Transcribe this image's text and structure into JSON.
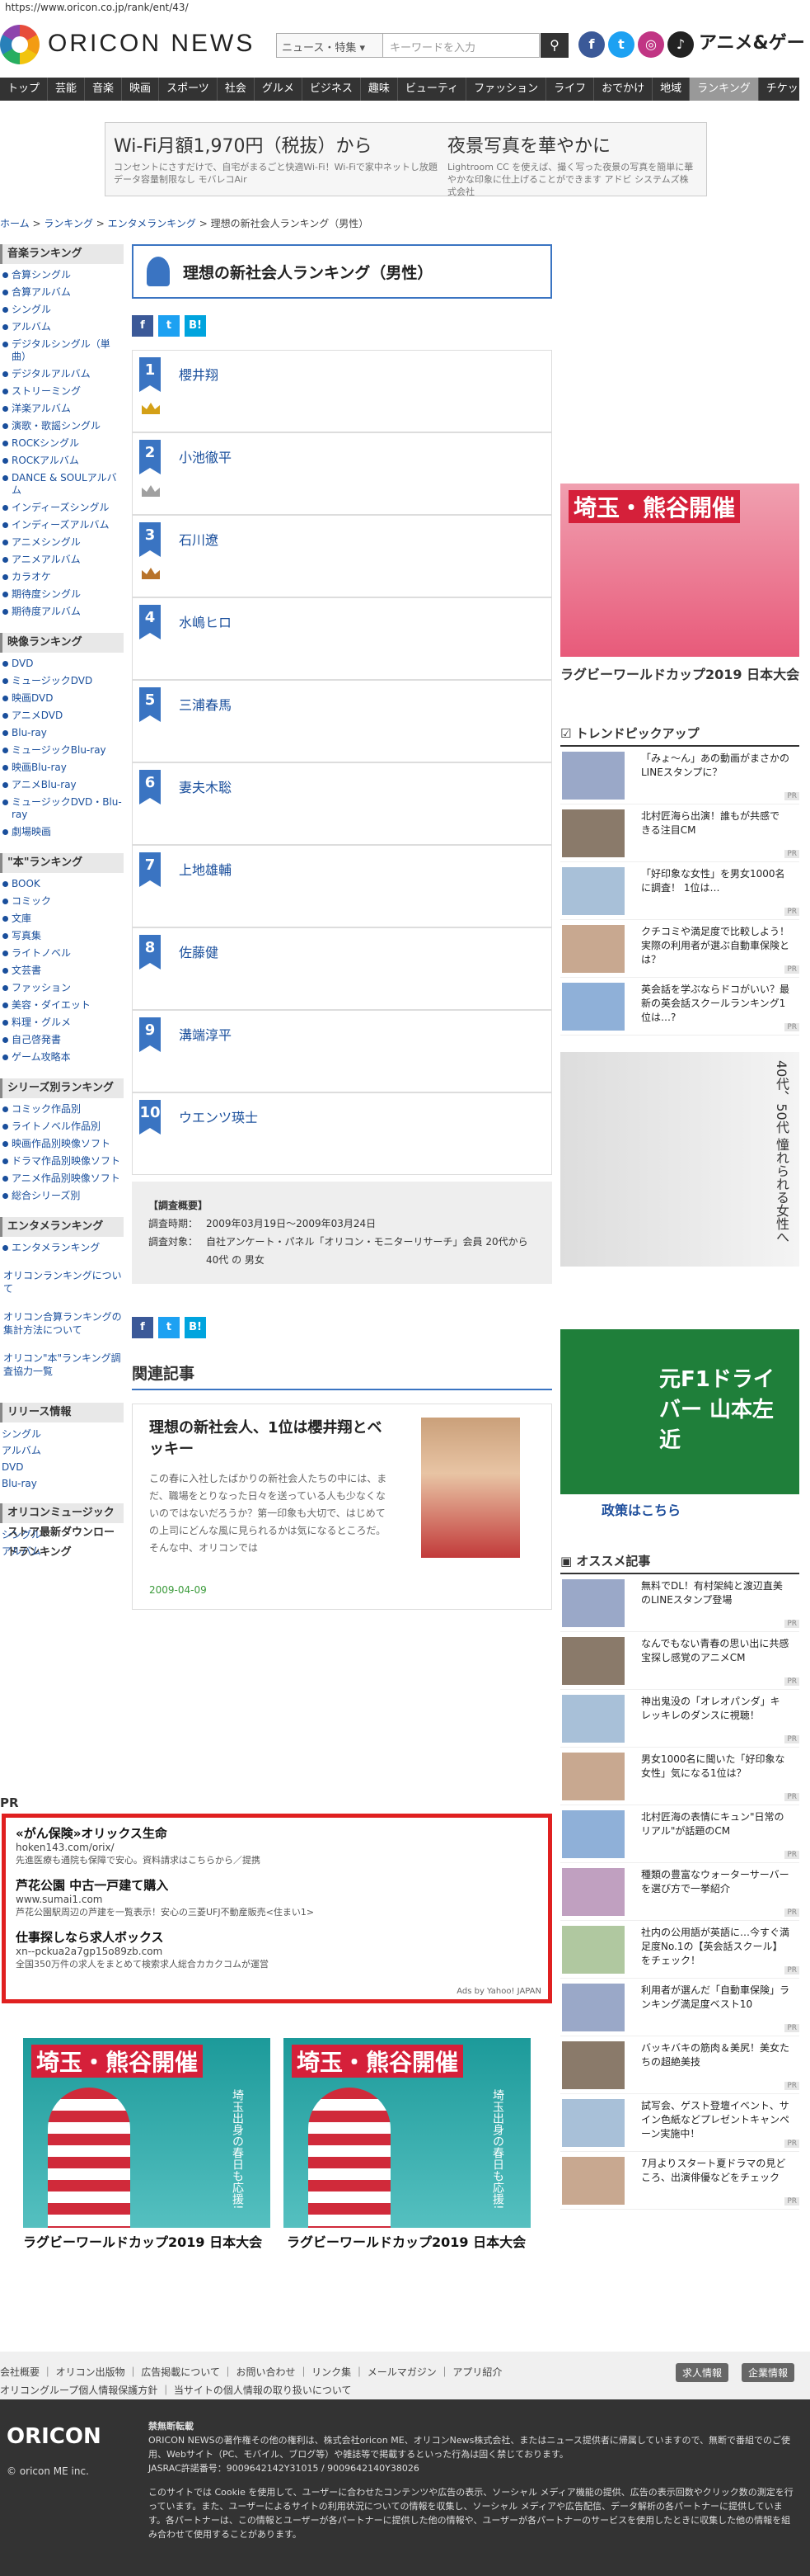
{
  "url": "https://www.oricon.co.jp/rank/ent/43/",
  "header": {
    "logo": "ORICON NEWS",
    "search_select": "ニュース・特集",
    "search_placeholder": "キーワードを入力",
    "anime": "アニメ&ゲー"
  },
  "nav": [
    "トップ",
    "芸能",
    "音楽",
    "映画",
    "スポーツ",
    "社会",
    "グルメ",
    "ビジネス",
    "趣味",
    "ビューティ",
    "ファッション",
    "ライフ",
    "おでかけ",
    "地域",
    "ランキング",
    "チケット"
  ],
  "ad_top": {
    "left_title": "Wi-Fi月額1,970円（税抜）から",
    "left_sub": "コンセントにさすだけで、自宅がまるごと快適Wi-Fi！Wi-Fiで家中ネットし放題データ容量制限なし モバレコAir",
    "right_title": "夜景写真を華やかに",
    "right_sub": "Lightroom CC を使えば、撮く写った夜景の写真を簡単に華やかな印象に仕上げることができます アドビ システムズ株式会社"
  },
  "breadcrumb": [
    "ホーム",
    "ランキング",
    "エンタメランキング",
    "理想の新社会人ランキング（男性）"
  ],
  "sidebar": {
    "music_head": "音楽ランキング",
    "music": [
      "合算シングル",
      "合算アルバム",
      "シングル",
      "アルバム",
      "デジタルシングル（単曲）",
      "デジタルアルバム",
      "ストリーミング",
      "洋楽アルバム",
      "演歌・歌謡シングル",
      "ROCKシングル",
      "ROCKアルバム",
      "DANCE & SOULアルバム",
      "インディーズシングル",
      "インディーズアルバム",
      "アニメシングル",
      "アニメアルバム",
      "カラオケ",
      "期待度シングル",
      "期待度アルバム"
    ],
    "video_head": "映像ランキング",
    "video": [
      "DVD",
      "ミュージックDVD",
      "映画DVD",
      "アニメDVD",
      "Blu-ray",
      "ミュージックBlu-ray",
      "映画Blu-ray",
      "アニメBlu-ray",
      "ミュージックDVD・Blu-ray",
      "劇場映画"
    ],
    "book_head": "\"本\"ランキング",
    "book": [
      "BOOK",
      "コミック",
      "文庫",
      "写真集",
      "ライトノベル",
      "文芸書",
      "ファッション",
      "美容・ダイエット",
      "料理・グルメ",
      "自己啓発書",
      "ゲーム攻略本"
    ],
    "series_head": "シリーズ別ランキング",
    "series": [
      "コミック作品別",
      "ライトノベル作品別",
      "映画作品別映像ソフト",
      "ドラマ作品別映像ソフト",
      "アニメ作品別映像ソフト",
      "総合シリーズ別"
    ],
    "ent_head": "エンタメランキング",
    "ent": [
      "エンタメランキング"
    ],
    "links": [
      "オリコンランキングについて",
      "オリコン合算ランキングの集計方法について",
      "オリコン\"本\"ランキング調査協力一覧"
    ],
    "release_head": "リリース情報",
    "release": [
      "シングル",
      "アルバム",
      "DVD",
      "Blu-ray"
    ],
    "dl_head": "オリコンミュージックストア最新ダウンロードランキング",
    "dl": [
      "シングル",
      "アルバム"
    ]
  },
  "main": {
    "title": "理想の新社会人ランキング（男性）",
    "share": [
      "f",
      "t",
      "B!"
    ],
    "ranks": [
      {
        "num": "1",
        "name": "櫻井翔"
      },
      {
        "num": "2",
        "name": "小池徹平"
      },
      {
        "num": "3",
        "name": "石川遼"
      },
      {
        "num": "4",
        "name": "水嶋ヒロ"
      },
      {
        "num": "5",
        "name": "三浦春馬"
      },
      {
        "num": "6",
        "name": "妻夫木聡"
      },
      {
        "num": "7",
        "name": "上地雄輔"
      },
      {
        "num": "8",
        "name": "佐藤健"
      },
      {
        "num": "9",
        "name": "溝端淳平"
      },
      {
        "num": "10",
        "name": "ウエンツ瑛士"
      }
    ],
    "survey": {
      "title": "【調査概要】",
      "period_k": "調査時期：",
      "period_v": "2009年03月19日〜2009年03月24日",
      "target_k": "調査対象：",
      "target_v": "自社アンケート・パネル「オリコン・モニターリサーチ」会員 20代から40代 の 男女"
    },
    "related_head": "関連記事",
    "related": {
      "title": "理想の新社会人、1位は櫻井翔とベッキー",
      "excerpt": "この春に入社したばかりの新社会人たちの中には、まだ、職場をとりなった日々を送っている人も少なくないのではないだろうか？第一印象も大切で、はじめての上司にどんな風に見られるかは気になるところだ。そんな中、オリコンでは",
      "date": "2009-04-09"
    }
  },
  "pr": {
    "label": "PR",
    "items": [
      {
        "title": "«がん保険»オリックス生命",
        "url": "hoken143.com/orix/",
        "desc": "先進医療も通院も保障で安心。資料請求はこちらから／提携"
      },
      {
        "title": "芦花公園 中古一戸建て購入",
        "url": "www.sumai1.com",
        "desc": "芦花公園駅周辺の芦建を一覧表示！安心の三菱UFJ不動産販売<住まい1>"
      },
      {
        "title": "仕事探しなら求人ボックス",
        "url": "xn--pckua2a7gp15o89zb.com",
        "desc": "全国350万件の求人をまとめて検索求人総合カカクコムが運営"
      }
    ],
    "foot": "Ads by Yahoo! JAPAN"
  },
  "banners": {
    "title": "埼玉・熊谷開催",
    "sub": "埼玉出身の春日も応援!",
    "caption": "ラグビーワールドカップ2019 日本大会"
  },
  "right": {
    "banner_title": "埼玉・熊谷開催",
    "banner_caption": "ラグビーワールドカップ2019 日本大会",
    "trend_head": "トレンドピックアップ",
    "trend": [
      "「みょ〜ん」あの動画がまさかのLINEスタンプに？",
      "北村匠海ら出演！誰もが共感できる注目CM",
      "「好印象な女性」を男女1000名に調査！ 1位は…",
      "クチコミや満足度で比較しよう！実際の利用者が選ぶ自動車保険とは？",
      "英会話を学ぶならドコがいい？最新の英会話スクールランキング1位は…?"
    ],
    "ad2_text": "40代、50代 憧れられる女性へ",
    "ad3_title": "元F1ドライバー 山本左近",
    "ad3_caption": "政策はこちら",
    "osusume_head": "オススメ記事",
    "osusume": [
      "無料でDL！有村架純と渡辺直美のLINEスタンプ登場",
      "なんでもない青春の思い出に共感 宝探し感覚のアニメCM",
      "神出鬼没の「オレオパンダ」キレッキレのダンスに視聴！",
      "男女1000名に聞いた「好印象な女性」気になる1位は？",
      "北村匠海の表情にキュン\"日常のリアル\"が話題のCM",
      "種類の豊富なウォーターサーバーを選び方で一挙紹介",
      "社内の公用語が英語に…今すぐ満足度No.1の【英会話スクール】をチェック！",
      "利用者が選んだ「自動車保険」ランキング満足度ベスト10",
      "バッキバキの筋肉＆美尻！美女たちの超絶美技",
      "試写会、ゲスト登壇イベント、サイン色紙などプレゼントキャンペーン実施中！",
      "7月よりスタート夏ドラマの見どころ、出演俳優などをチェック"
    ]
  },
  "footer": {
    "links": "会社概要 ｜ オリコン出版物 ｜ 広告掲載について ｜ お問い合わせ ｜ リンク集 ｜ メールマガジン ｜ アプリ紹介",
    "links2": "オリコングループ個人情報保護方針 ｜ 当サイトの個人情報の取り扱いについて",
    "btn1": "求人情報",
    "btn2": "企業情報",
    "logo": "ORICON",
    "copy": "© oricon ME inc.",
    "notice_head": "禁無断転載",
    "notice": "ORICON NEWSの著作権その他の権利は、株式会社oricon ME、オリコンNews株式会社、またはニュース提供者に帰属していますので、無断で番組でのご使用、Webサイト（PC、モバイル、ブログ等）や雑誌等で掲載するといった行為は固く禁じております。",
    "jasrac": "JASRAC許諾番号：9009642142Y31015 / 9009642140Y38026",
    "cookie": "このサイトでは Cookie を使用して、ユーザーに合わせたコンテンツや広告の表示、ソーシャル メディア機能の提供、広告の表示回数やクリック数の測定を行っています。また、ユーザーによるサイトの利用状況についての情報を収集し、ソーシャル メディアや広告配信、データ解析の各パートナーに提供しています。各パートナーは、この情報とユーザーが各パートナーに提供した他の情報や、ユーザーが各パートナーのサービスを使用したときに収集した他の情報を組み合わせて使用することがあります。"
  },
  "colors": {
    "accent": "#3a74c2",
    "nav": "#333333",
    "pr_border": "#e02020"
  }
}
